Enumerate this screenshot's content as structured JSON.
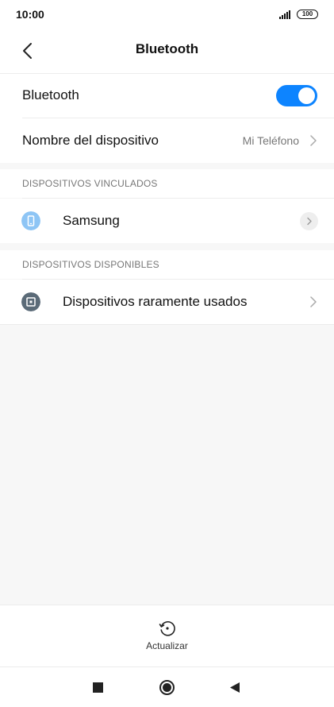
{
  "status_bar": {
    "time": "10:00",
    "battery": "100"
  },
  "header": {
    "title": "Bluetooth",
    "back_icon": "chevron-left-icon"
  },
  "settings": {
    "bluetooth_label": "Bluetooth",
    "bluetooth_enabled": true,
    "device_name_label": "Nombre del dispositivo",
    "device_name_value": "Mi Teléfono"
  },
  "paired": {
    "header": "DISPOSITIVOS VINCULADOS",
    "devices": [
      {
        "name": "Samsung",
        "icon": "phone-icon",
        "icon_color": "#8ec5f5"
      }
    ]
  },
  "available": {
    "header": "DISPOSITIVOS DISPONIBLES",
    "items": [
      {
        "name": "Dispositivos raramente usados",
        "icon": "device-square-icon",
        "icon_color": "#5b6b78"
      }
    ]
  },
  "bottom": {
    "refresh_label": "Actualizar"
  },
  "colors": {
    "accent": "#0d84ff",
    "background": "#f7f7f7"
  }
}
